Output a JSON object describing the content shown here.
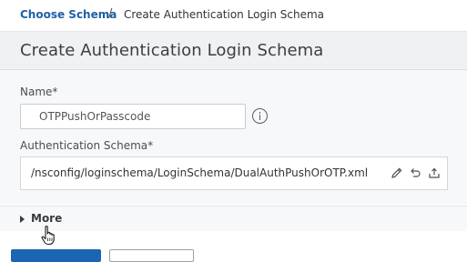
{
  "breadcrumb": {
    "parent_label": "Choose Schema",
    "separator": "/",
    "current_label": "Create Authentication Login Schema"
  },
  "page": {
    "title": "Create Authentication Login Schema"
  },
  "form": {
    "name_label": "Name*",
    "name_value": "OTPPushOrPasscode",
    "schema_label": "Authentication Schema*",
    "schema_value": "/nsconfig/loginschema/LoginSchema/DualAuthPushOrOTP.xml"
  },
  "more": {
    "label": "More"
  },
  "icons": {
    "info": "info-icon",
    "edit": "pencil-icon",
    "undo": "undo-icon",
    "upload": "upload-icon",
    "expand": "caret-right-icon",
    "cursor": "hand-pointer-icon"
  },
  "colors": {
    "link": "#1f5fa6",
    "primary_button": "#1a66b2",
    "title_band": "#f0f1f3",
    "form_background": "#f7f8fa"
  }
}
